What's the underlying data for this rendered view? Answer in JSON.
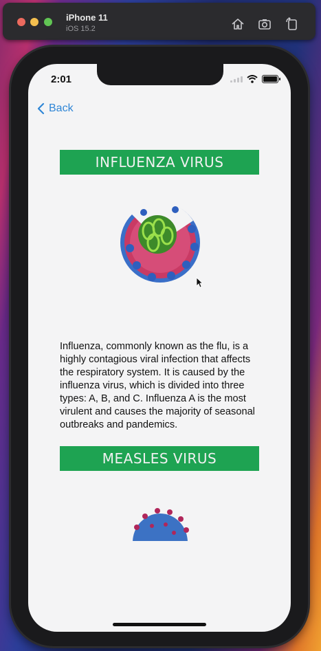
{
  "simulator": {
    "device_name": "iPhone 11",
    "os_version": "iOS 15.2",
    "toolbar_icons": [
      "home-icon",
      "screenshot-icon",
      "rotate-icon"
    ]
  },
  "status_bar": {
    "time": "2:01"
  },
  "nav": {
    "back_label": "Back"
  },
  "sections": [
    {
      "title": "INFLUENZA VIRUS",
      "description": "Influenza, commonly known as the flu, is a highly contagious viral infection that affects the respiratory system. It is caused by the influenza virus, which is divided into three types: A, B, and C. Influenza A is the most virulent and causes the majority of seasonal outbreaks and pandemics."
    },
    {
      "title": "MEASLES VIRUS"
    }
  ],
  "colors": {
    "banner": "#1ea352",
    "link": "#2f86d6",
    "screen_bg": "#f4f4f5"
  }
}
